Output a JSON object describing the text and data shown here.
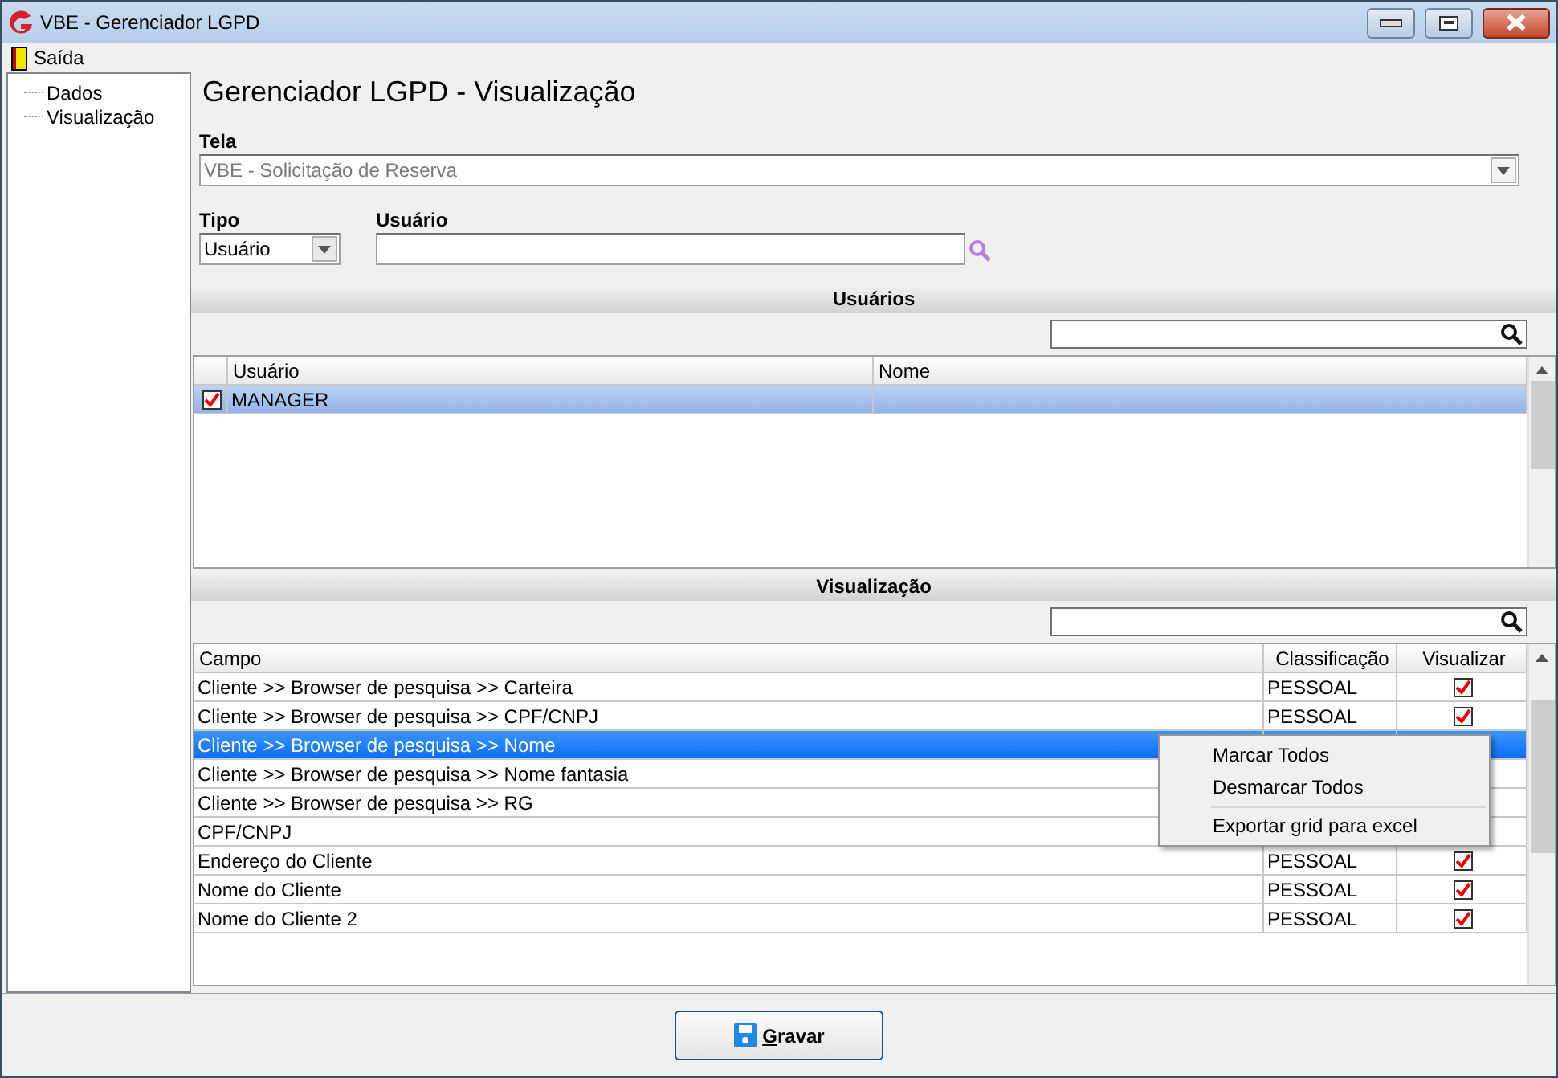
{
  "window": {
    "title": "VBE - Gerenciador LGPD"
  },
  "menu": [
    {
      "label": "Saída"
    }
  ],
  "tree": [
    {
      "label": "Dados"
    },
    {
      "label": "Visualização"
    }
  ],
  "heading": "Gerenciador LGPD - Visualização",
  "tela": {
    "label": "Tela",
    "value": "VBE - Solicitação de Reserva",
    "disabled": true
  },
  "tipo": {
    "label": "Tipo",
    "value": "Usuário"
  },
  "usuario": {
    "label": "Usuário"
  },
  "usuarios": {
    "title": "Usuários",
    "columns": [
      "Usuário",
      "Nome"
    ],
    "rows": [
      {
        "usuario": "MANAGER",
        "checked": true,
        "selected": true
      }
    ]
  },
  "visualizacao": {
    "title": "Visualização",
    "columns": [
      "Campo",
      "Classificação",
      "Visualizar"
    ],
    "rows": [
      {
        "campo": "Cliente >> Browser de pesquisa >> Carteira",
        "classificacao": "PESSOAL",
        "visualizar": true,
        "selected": false
      },
      {
        "campo": "Cliente >> Browser de pesquisa >> CPF/CNPJ",
        "classificacao": "PESSOAL",
        "visualizar": true,
        "selected": false
      },
      {
        "campo": "Cliente >> Browser de pesquisa >> Nome",
        "selected": true
      },
      {
        "campo": "Cliente >> Browser de pesquisa >> Nome fantasia",
        "selected": false
      },
      {
        "campo": "Cliente >> Browser de pesquisa >> RG",
        "selected": false
      },
      {
        "campo": "CPF/CNPJ",
        "selected": false
      },
      {
        "campo": "Endereço do Cliente",
        "classificacao": "PESSOAL",
        "visualizar": true,
        "selected": false
      },
      {
        "campo": "Nome do Cliente",
        "classificacao": "PESSOAL",
        "visualizar": true,
        "selected": false
      },
      {
        "campo": "Nome do Cliente 2",
        "classificacao": "PESSOAL",
        "visualizar": true,
        "selected": false
      }
    ]
  },
  "context_menu": {
    "items": [
      {
        "kind": "item",
        "label": "Marcar Todos"
      },
      {
        "kind": "item",
        "label": "Desmarcar Todos"
      },
      {
        "kind": "separator"
      },
      {
        "kind": "item",
        "label": "Exportar grid para excel"
      }
    ]
  },
  "save_button": {
    "label": "Gravar"
  }
}
